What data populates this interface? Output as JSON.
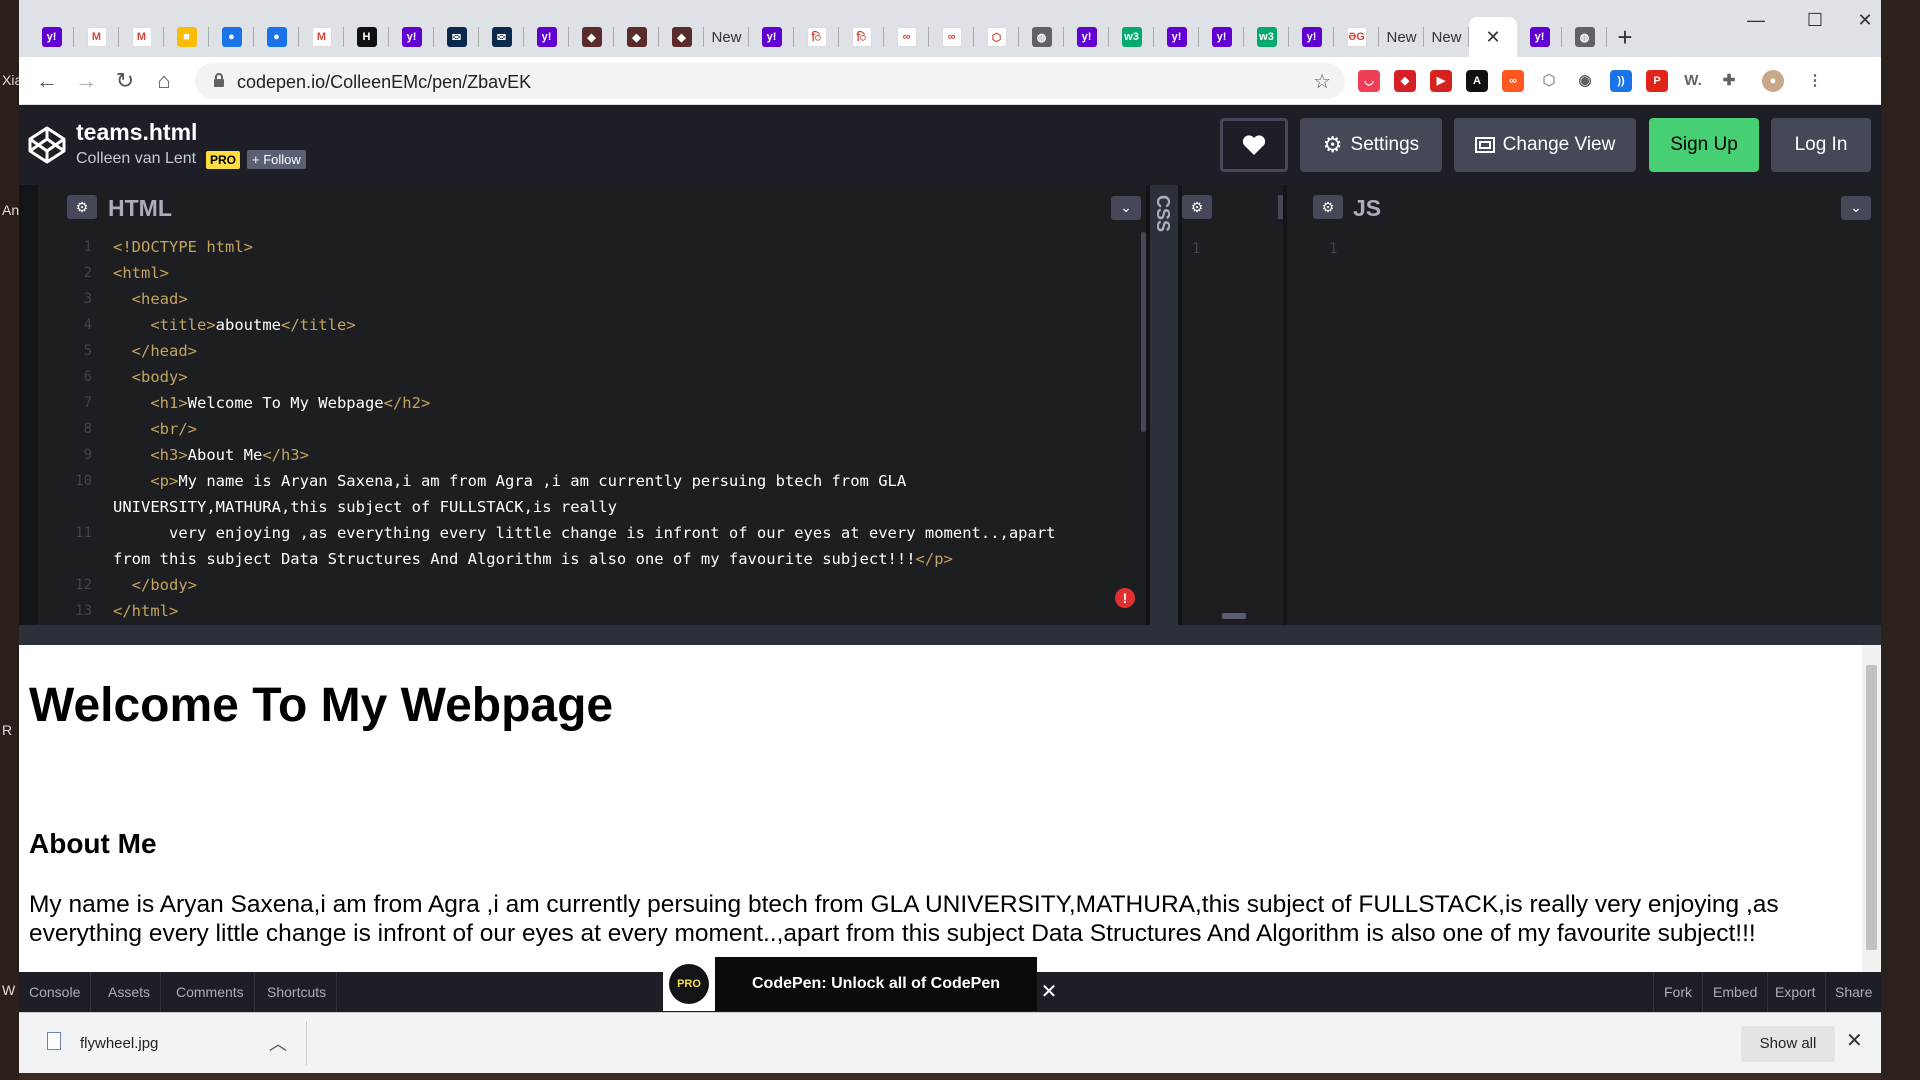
{
  "desktop": {
    "left_labels": [
      "Xia",
      "An",
      "R",
      "W"
    ]
  },
  "browser": {
    "tabs": [
      {
        "icon": "yahoo-icon",
        "color": "#6001d2",
        "glyph": "y!"
      },
      {
        "icon": "gmail-icon",
        "color": "#ffffff",
        "glyph": "M"
      },
      {
        "icon": "gmail-icon",
        "color": "#ffffff",
        "glyph": "M"
      },
      {
        "icon": "keep-icon",
        "color": "#fbbc04",
        "glyph": "■"
      },
      {
        "icon": "contacts-icon",
        "color": "#1a73e8",
        "glyph": "●"
      },
      {
        "icon": "contacts-icon",
        "color": "#1a73e8",
        "glyph": "●"
      },
      {
        "icon": "gmail-icon",
        "color": "#ffffff",
        "glyph": "M"
      },
      {
        "icon": "hackerrank-icon",
        "color": "#111111",
        "glyph": "H"
      },
      {
        "icon": "yahoo-icon",
        "color": "#6001d2",
        "glyph": "y!"
      },
      {
        "icon": "mail-icon",
        "color": "#0b2a4a",
        "glyph": "✉"
      },
      {
        "icon": "mail-icon",
        "color": "#0b2a4a",
        "glyph": "✉"
      },
      {
        "icon": "yahoo-icon",
        "color": "#6001d2",
        "glyph": "y!"
      },
      {
        "icon": "avatar-icon",
        "color": "#5a2b2b",
        "glyph": "◆"
      },
      {
        "icon": "avatar-icon",
        "color": "#5a2b2b",
        "glyph": "◆"
      },
      {
        "icon": "avatar-icon",
        "color": "#5a2b2b",
        "glyph": "◆"
      },
      {
        "icon": "text-tab",
        "text": "New"
      },
      {
        "icon": "yahoo-icon",
        "color": "#6001d2",
        "glyph": "y!"
      },
      {
        "icon": "hindi-icon",
        "color": "#ffffff",
        "glyph": "ि"
      },
      {
        "icon": "hindi-icon",
        "color": "#ffffff",
        "glyph": "ि"
      },
      {
        "icon": "infinity-icon",
        "color": "#ffffff",
        "glyph": "∞"
      },
      {
        "icon": "infinity-icon",
        "color": "#ffffff",
        "glyph": "∞"
      },
      {
        "icon": "codepen-icon",
        "color": "#ffffff",
        "glyph": "⬡"
      },
      {
        "icon": "globe-icon",
        "color": "#5f6368",
        "glyph": "◍"
      },
      {
        "icon": "yahoo-icon",
        "color": "#6001d2",
        "glyph": "y!"
      },
      {
        "icon": "w3-icon",
        "color": "#04aa6d",
        "glyph": "w3"
      },
      {
        "icon": "yahoo-icon",
        "color": "#6001d2",
        "glyph": "y!"
      },
      {
        "icon": "yahoo-icon",
        "color": "#6001d2",
        "glyph": "y!"
      },
      {
        "icon": "w3-icon",
        "color": "#04aa6d",
        "glyph": "w3"
      },
      {
        "icon": "yahoo-icon",
        "color": "#6001d2",
        "glyph": "y!"
      },
      {
        "icon": "gfg-icon",
        "color": "#ffffff",
        "glyph": "ƏG"
      },
      {
        "icon": "text-tab",
        "text": "New"
      },
      {
        "icon": "text-tab",
        "text": "New"
      },
      {
        "icon": "close-icon",
        "active": true,
        "glyph": "✕"
      },
      {
        "icon": "yahoo-icon",
        "color": "#6001d2",
        "glyph": "y!"
      },
      {
        "icon": "globe-icon",
        "color": "#5f6368",
        "glyph": "◍"
      }
    ],
    "new_tab_glyph": "+",
    "window_controls": {
      "minimize": "—",
      "maximize": "☐",
      "close": "✕"
    },
    "url": "codepen.io/ColleenEMc/pen/ZbavEK",
    "extensions": [
      {
        "icon": "pocket-icon",
        "color": "#ef3f56",
        "glyph": "◡"
      },
      {
        "icon": "shield-icon",
        "color": "#d61f26",
        "glyph": "◆"
      },
      {
        "icon": "record-icon",
        "color": "#d6221f",
        "glyph": "▶"
      },
      {
        "icon": "font-icon",
        "color": "#111111",
        "glyph": "A"
      },
      {
        "icon": "loop-icon",
        "color": "#ff5722",
        "glyph": "∞"
      },
      {
        "icon": "hex-icon",
        "color": "#9aa0a6",
        "glyph": "⬡"
      },
      {
        "icon": "compass-icon",
        "color": "#5f6368",
        "glyph": "◉"
      },
      {
        "icon": "wave-icon",
        "color": "#1a73e8",
        "glyph": "))"
      },
      {
        "icon": "pdf-icon",
        "color": "#e2231a",
        "glyph": "P"
      },
      {
        "icon": "w-icon",
        "color": "#5f6368",
        "glyph": "W."
      },
      {
        "icon": "puzzle-icon",
        "color": "#5f6368",
        "glyph": "✚"
      },
      {
        "icon": "profile-icon",
        "color": "#c9a88a",
        "glyph": "●"
      },
      {
        "icon": "menu-icon",
        "color": "#5f6368",
        "glyph": "⋮"
      }
    ]
  },
  "codepen": {
    "title": "teams.html",
    "author": "Colleen van Lent",
    "pro_badge": "PRO",
    "follow_label": "+ Follow",
    "settings_label": "Settings",
    "change_view_label": "Change View",
    "signup_label": "Sign Up",
    "login_label": "Log In",
    "html_pane": {
      "title": "HTML"
    },
    "css_pane": {
      "title": "CSS"
    },
    "js_pane": {
      "title": "JS"
    },
    "html_code": [
      {
        "n": "1",
        "html": "<span class='tg'>&lt;!DOCTYPE html&gt;</span>"
      },
      {
        "n": "2",
        "html": "<span class='tg'>&lt;html&gt;</span>"
      },
      {
        "n": "3",
        "html": "  <span class='tg'>&lt;head&gt;</span>"
      },
      {
        "n": "4",
        "html": "    <span class='tg'>&lt;title&gt;</span>aboutme<span class='tg'>&lt;/title&gt;</span>"
      },
      {
        "n": "5",
        "html": "  <span class='tg'>&lt;/head&gt;</span>"
      },
      {
        "n": "6",
        "html": "  <span class='tg'>&lt;body&gt;</span>"
      },
      {
        "n": "7",
        "html": "    <span class='tg'>&lt;h1&gt;</span>Welcome To My Webpage<span class='tg'>&lt;/h2&gt;</span>"
      },
      {
        "n": "8",
        "html": "    <span class='tg'>&lt;br/&gt;</span>"
      },
      {
        "n": "9",
        "html": "    <span class='tg'>&lt;h3&gt;</span>About Me<span class='tg'>&lt;/h3&gt;</span>"
      },
      {
        "n": "10",
        "html": "    <span class='tg'>&lt;p&gt;</span>My name is Aryan Saxena,i am from Agra ,i am currently persuing btech from GLA"
      },
      {
        "n": "",
        "html": "UNIVERSITY,MATHURA,this subject of FULLSTACK,is really"
      },
      {
        "n": "11",
        "html": "      very enjoying ,as everything every little change is infront of our eyes at every moment..,apart"
      },
      {
        "n": "",
        "html": "from this subject Data Structures And Algorithm is also one of my favourite subject!!!<span class='tg'>&lt;/p&gt;</span>"
      },
      {
        "n": "12",
        "html": "  <span class='tg'>&lt;/body&gt;</span>"
      },
      {
        "n": "13",
        "html": "<span class='tg'>&lt;/html&gt;</span>"
      }
    ],
    "css_line": "1",
    "js_line": "1"
  },
  "preview": {
    "h1": "Welcome To My Webpage",
    "h3": "About Me",
    "p": "My name is Aryan Saxena,i am from Agra ,i am currently persuing btech from GLA UNIVERSITY,MATHURA,this subject of FULLSTACK,is really very enjoying ,as everything every little change is infront of our eyes at every moment..,apart from this subject Data Structures And Algorithm is also one of my favourite subject!!!"
  },
  "footer": {
    "left": [
      "Console",
      "Assets",
      "Comments",
      "Shortcuts"
    ],
    "right": [
      "Fork",
      "Embed",
      "Export",
      "Share"
    ],
    "promo_badge": "PRO",
    "promo_text": "CodePen: Unlock all of CodePen",
    "promo_close": "✕"
  },
  "downloads": {
    "file": "flywheel.jpg",
    "show_all": "Show all",
    "close": "✕"
  }
}
